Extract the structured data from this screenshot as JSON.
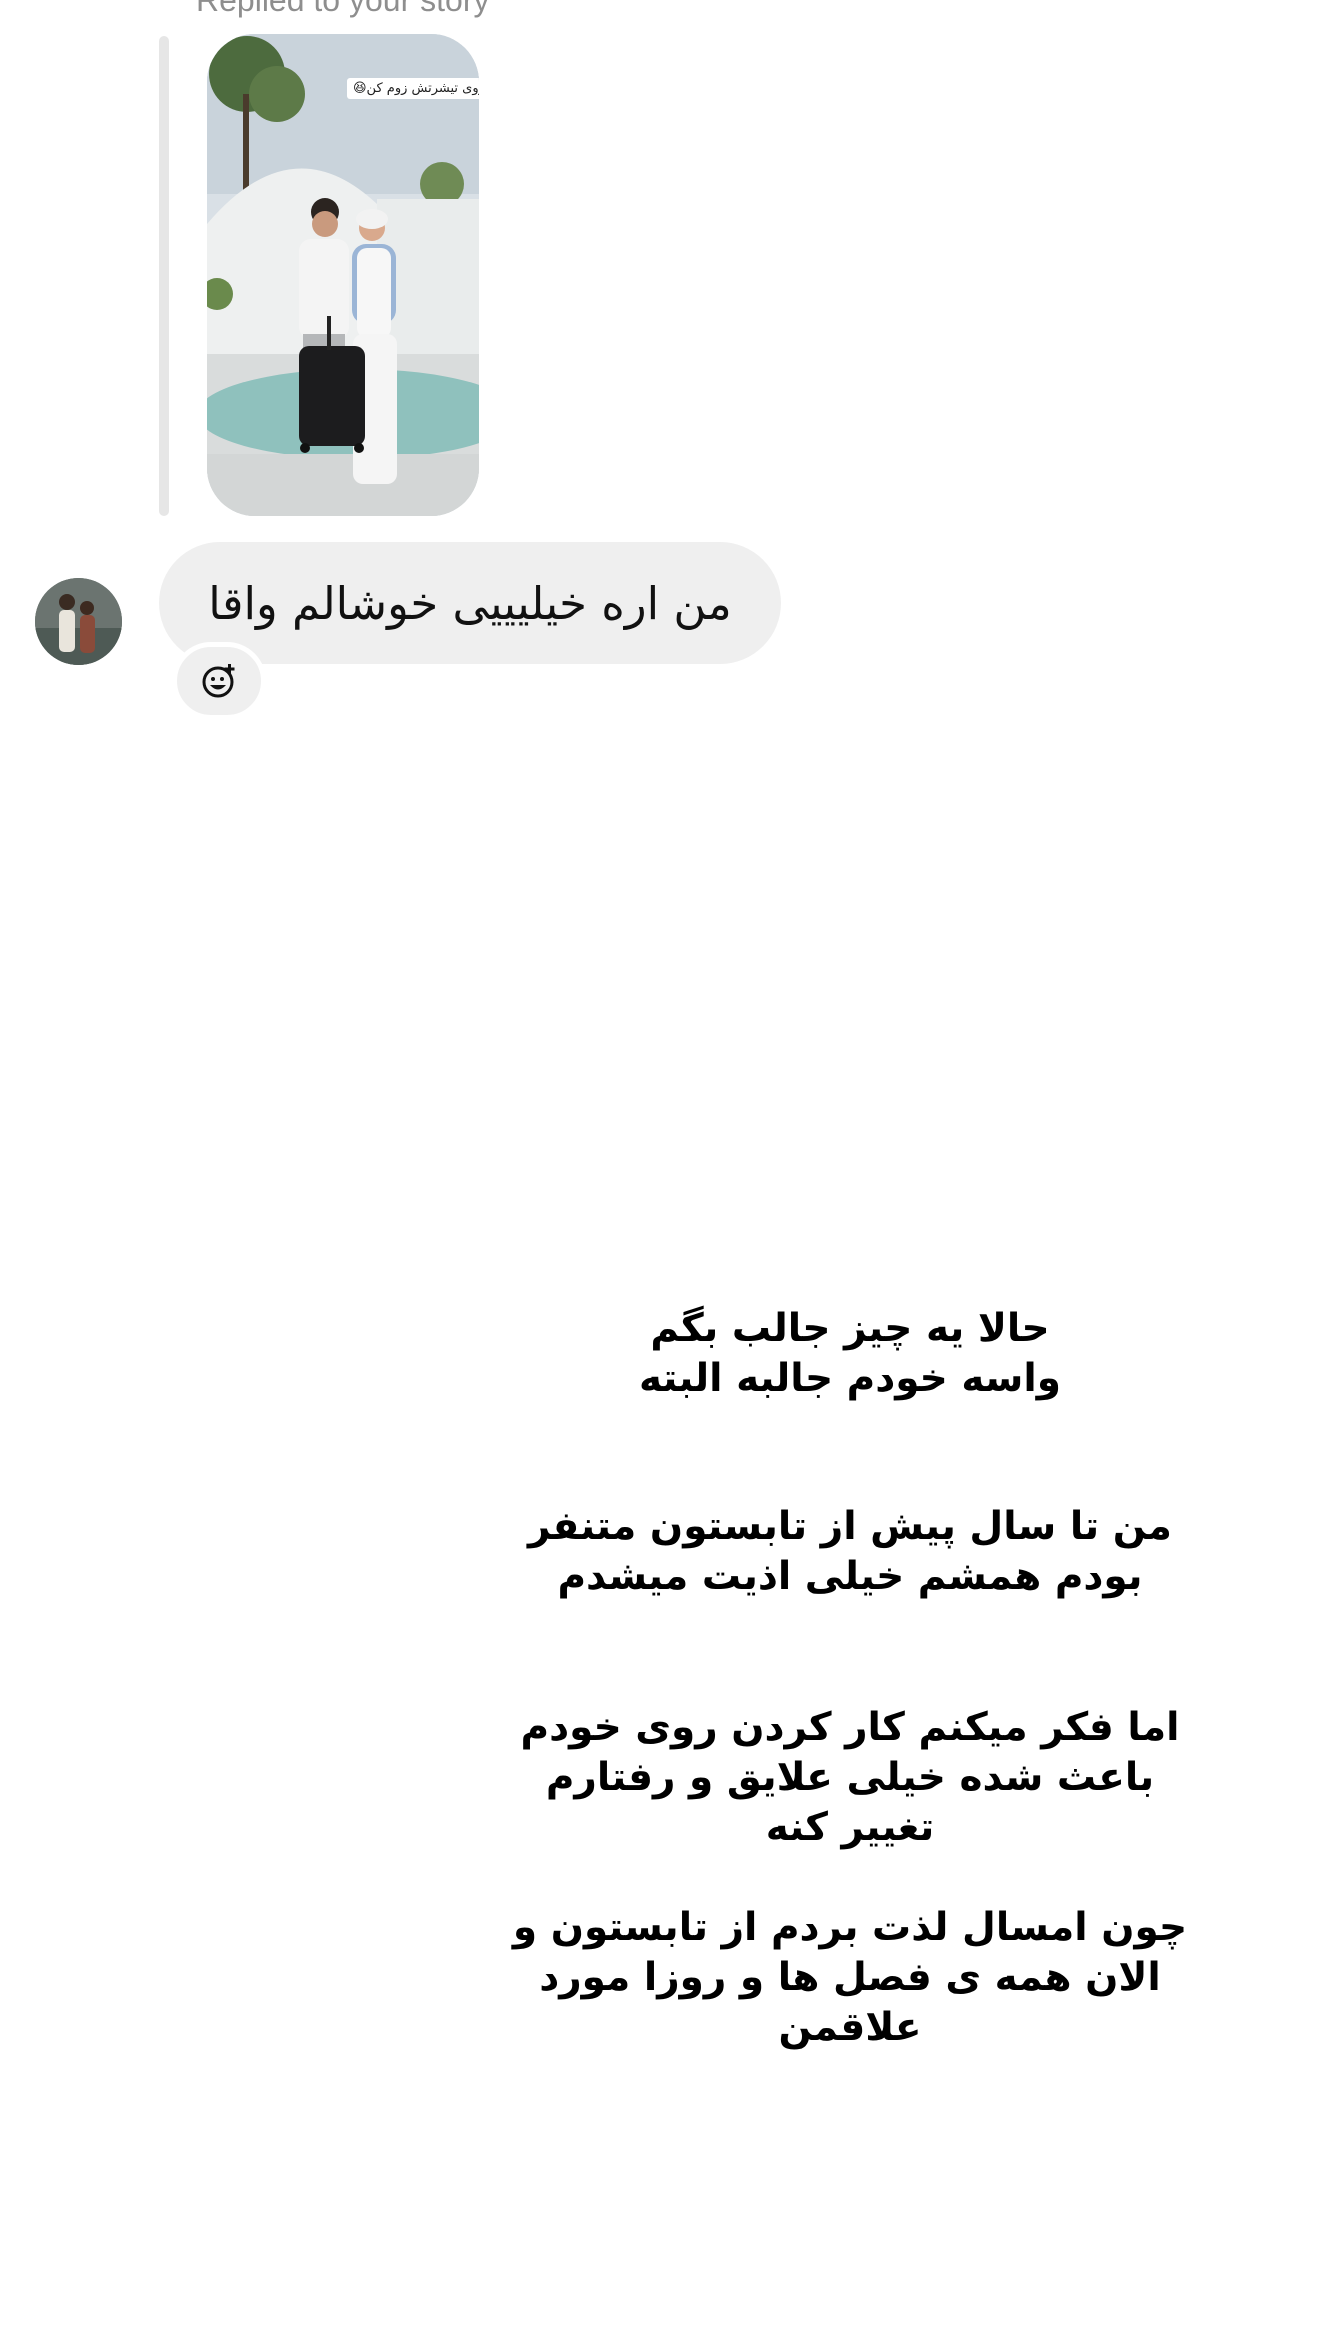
{
  "reply": {
    "label": "Replied to your story",
    "story_sticker": "روی تیشرتش زوم کن😆"
  },
  "message": {
    "text": "من اره خیلیییی خوشالم واقا",
    "react_icon": "add-reaction-icon"
  },
  "story_text": {
    "paragraph_1": [
      "حالا یه چیز جالب بگم",
      "واسه خودم جالبه البته"
    ],
    "paragraph_2": [
      "من تا سال پیش از تابستون متنفر",
      "بودم همشم خیلی اذیت میشدم"
    ],
    "paragraph_3": [
      "اما فکر میکنم کار کردن روی خودم",
      "باعث شده خیلی علایق و رفتارم",
      "تغییر کنه"
    ],
    "paragraph_4": [
      "چون امسال لذت بردم از تابستون و",
      "الان همه ی فصل ها و روزا مورد",
      "علاقمن"
    ]
  },
  "colors": {
    "bubble": "#efefef",
    "muted_text": "#8e8e8e",
    "reply_bar": "#e6e6e6"
  }
}
